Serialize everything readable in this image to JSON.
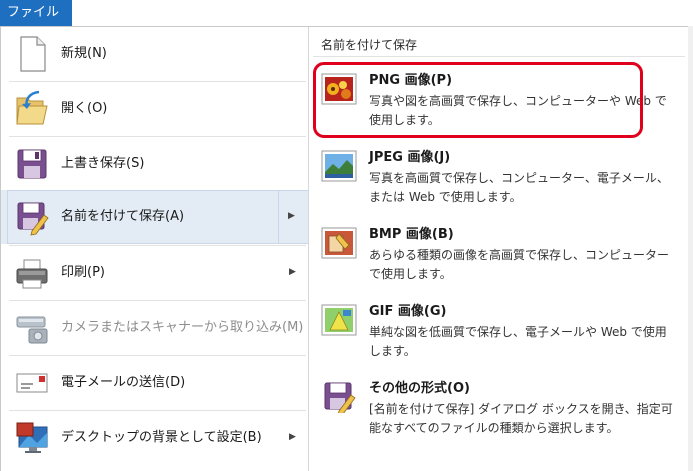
{
  "top": {
    "file_tab": "ファイル"
  },
  "left_menu": {
    "items": [
      {
        "label": "新規(N)",
        "icon": "new-document-icon"
      },
      {
        "label": "開く(O)",
        "icon": "open-folder-icon"
      },
      {
        "label": "上書き保存(S)",
        "icon": "save-disk-icon"
      },
      {
        "label": "名前を付けて保存(A)",
        "icon": "save-as-icon"
      },
      {
        "label": "印刷(P)",
        "icon": "printer-icon"
      },
      {
        "label": "カメラまたはスキャナーから取り込み(M)",
        "icon": "scanner-camera-icon"
      },
      {
        "label": "電子メールの送信(D)",
        "icon": "email-icon"
      },
      {
        "label": "デスクトップの背景として設定(B)",
        "icon": "desktop-background-icon"
      }
    ],
    "selected_index": 3
  },
  "right_panel": {
    "heading": "名前を付けて保存",
    "options": [
      {
        "title": "PNG 画像(P)",
        "desc": "写真や図を高画質で保存し、コンピューターや Web で使用します。",
        "icon": "png-image-icon"
      },
      {
        "title": "JPEG 画像(J)",
        "desc": "写真を高画質で保存し、コンピューター、電子メール、または Web で使用します。",
        "icon": "jpeg-image-icon"
      },
      {
        "title": "BMP 画像(B)",
        "desc": "あらゆる種類の画像を高画質で保存し、コンピューターで使用します。",
        "icon": "bmp-image-icon"
      },
      {
        "title": "GIF 画像(G)",
        "desc": "単純な図を低画質で保存し、電子メールや Web で使用します。",
        "icon": "gif-image-icon"
      },
      {
        "title": "その他の形式(O)",
        "desc": "[名前を付けて保存] ダイアログ ボックスを開き、指定可能なすべてのファイルの種類から選択します。",
        "icon": "other-formats-icon"
      }
    ],
    "highlighted_index": 0
  },
  "colors": {
    "file_tab": "#1e6fc0",
    "selected_item": "#e3ebf5",
    "highlight_border": "#e0001b"
  }
}
